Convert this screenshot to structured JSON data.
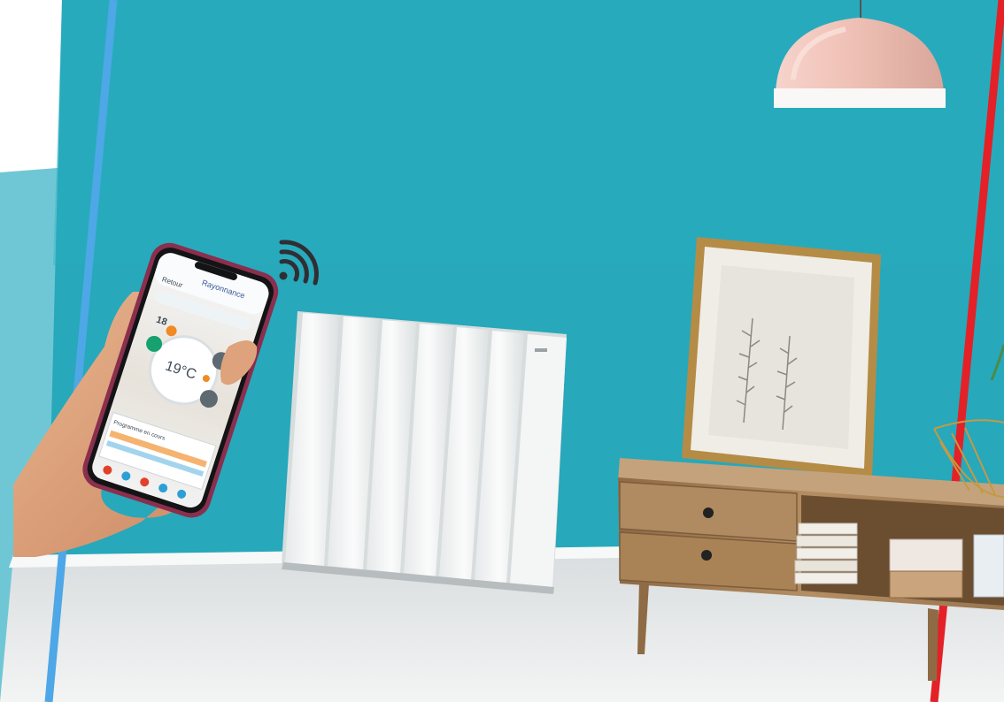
{
  "scene": {
    "colors": {
      "wall": "#27a8bb",
      "wall_left_panel": "#6dc6d4",
      "floor": "#e9ebec",
      "blue_line": "#4ea7e6",
      "red_line": "#e32127",
      "radiator": "#f4f5f5",
      "wood": "#a9825a",
      "lamp": "#f1c6bd",
      "frame": "#b9924a"
    },
    "icons": [
      "wifi-signal-icon"
    ]
  },
  "phone": {
    "header_back": "Retour",
    "brand": "Rayonnance",
    "setpoint_small": "18",
    "temperature": "19°C",
    "schedule_label": "Programme en cours"
  }
}
